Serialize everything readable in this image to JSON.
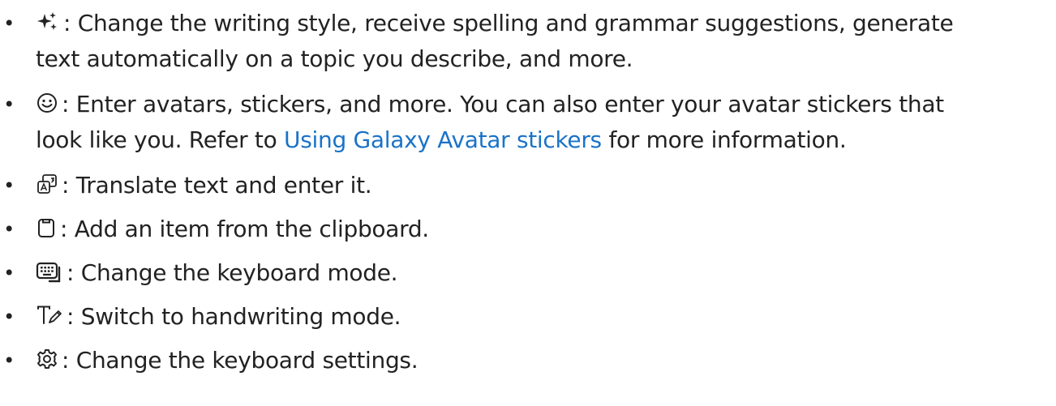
{
  "items": [
    {
      "icon": "sparkle-icon",
      "line1": ": Change the writing style, receive spelling and grammar suggestions, generate",
      "line2": "text automatically on a topic you describe, and more."
    },
    {
      "icon": "smiley-icon",
      "line1": ": Enter avatars, stickers, and more. You can also enter your avatar stickers that",
      "line2_pre": "look like you. Refer to ",
      "line2_link": "Using Galaxy Avatar stickers",
      "line2_post": " for more information."
    },
    {
      "icon": "translate-icon",
      "line1": ": Translate text and enter it."
    },
    {
      "icon": "clipboard-icon",
      "line1": ": Add an item from the clipboard."
    },
    {
      "icon": "keyboard-mode-icon",
      "line1": ": Change the keyboard mode."
    },
    {
      "icon": "handwriting-icon",
      "line1": ": Switch to handwriting mode."
    },
    {
      "icon": "gear-icon",
      "line1": ": Change the keyboard settings."
    }
  ],
  "bullet": "•",
  "colors": {
    "text": "#222222",
    "link": "#1a73c8"
  }
}
